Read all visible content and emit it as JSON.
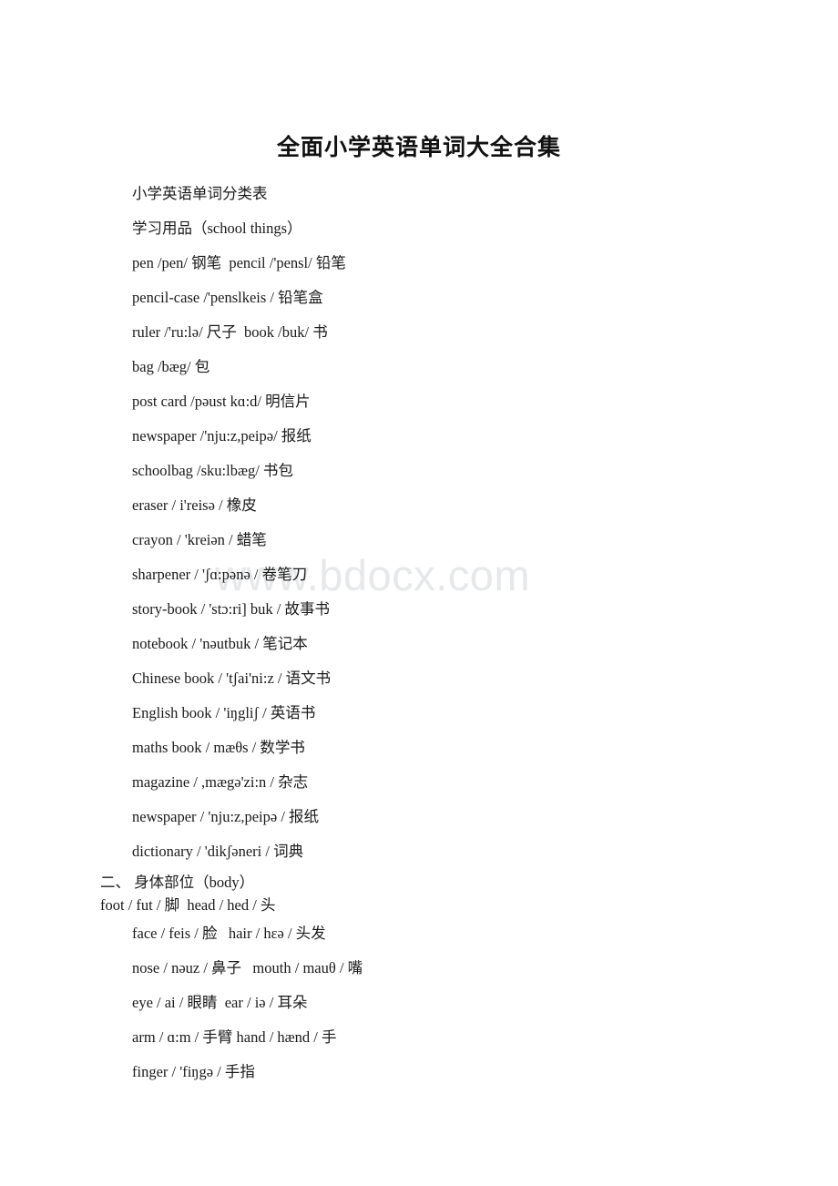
{
  "document": {
    "title": "全面小学英语单词大全合集",
    "watermark": "www.bdocx.com"
  },
  "lines": [
    {
      "id": "subtitle",
      "text": "小学英语单词分类表",
      "indent": "normal"
    },
    {
      "id": "section-school-things",
      "text": "学习用品（school things）",
      "indent": "normal"
    },
    {
      "id": "entry-pen-pencil",
      "text": "pen /pen/ 钢笔  pencil /'pensl/ 铅笔",
      "indent": "normal"
    },
    {
      "id": "entry-pencil-case",
      "text": "pencil-case /'penslkeis / 铅笔盒",
      "indent": "normal"
    },
    {
      "id": "entry-ruler-book",
      "text": "ruler /'ru:lə/ 尺子  book /buk/ 书",
      "indent": "normal"
    },
    {
      "id": "entry-bag",
      "text": "bag /bæg/ 包",
      "indent": "normal"
    },
    {
      "id": "entry-post-card",
      "text": "post card /pəust kɑ:d/ 明信片",
      "indent": "normal"
    },
    {
      "id": "entry-newspaper-1",
      "text": "newspaper /'nju:z,peipə/ 报纸",
      "indent": "normal"
    },
    {
      "id": "entry-schoolbag",
      "text": "schoolbag /sku:lbæg/ 书包",
      "indent": "normal"
    },
    {
      "id": "entry-eraser",
      "text": "eraser / i'reisə / 橡皮",
      "indent": "normal"
    },
    {
      "id": "entry-crayon",
      "text": "crayon / 'kreiən / 蜡笔",
      "indent": "normal"
    },
    {
      "id": "entry-sharpener",
      "text": "sharpener / 'ʃɑ:pənə / 卷笔刀",
      "indent": "normal"
    },
    {
      "id": "entry-story-book",
      "text": "story-book / 'stɔ:ri] buk / 故事书",
      "indent": "normal"
    },
    {
      "id": "entry-notebook",
      "text": "notebook / 'nəutbuk / 笔记本",
      "indent": "normal"
    },
    {
      "id": "entry-chinese-book",
      "text": "Chinese book / 'tʃai'ni:z / 语文书",
      "indent": "normal"
    },
    {
      "id": "entry-english-book",
      "text": "English book / 'iŋgliʃ / 英语书",
      "indent": "normal"
    },
    {
      "id": "entry-maths-book",
      "text": "maths book / mæθs / 数学书",
      "indent": "normal"
    },
    {
      "id": "entry-magazine",
      "text": "magazine / ,mægə'zi:n / 杂志",
      "indent": "normal"
    },
    {
      "id": "entry-newspaper-2",
      "text": "newspaper / 'nju:z,peipə / 报纸",
      "indent": "normal"
    },
    {
      "id": "entry-dictionary",
      "text": "dictionary / 'dikʃəneri / 词典",
      "indent": "normal"
    },
    {
      "id": "section-body",
      "text": "二、 身体部位（body）",
      "indent": "outdent"
    },
    {
      "id": "entry-foot-head",
      "text": "foot / fut / 脚  head / hed / 头",
      "indent": "outdent"
    },
    {
      "id": "entry-face-hair",
      "text": "face / feis / 脸   hair / hɛə / 头发",
      "indent": "normal"
    },
    {
      "id": "entry-nose-mouth",
      "text": "nose / nəuz / 鼻子   mouth / mauθ / 嘴",
      "indent": "normal"
    },
    {
      "id": "entry-eye-ear",
      "text": "eye / ai / 眼睛  ear / iə / 耳朵",
      "indent": "normal"
    },
    {
      "id": "entry-arm-hand",
      "text": "arm / ɑ:m / 手臂 hand / hænd / 手",
      "indent": "normal"
    },
    {
      "id": "entry-finger",
      "text": "finger / 'fiŋgə / 手指",
      "indent": "normal"
    }
  ]
}
